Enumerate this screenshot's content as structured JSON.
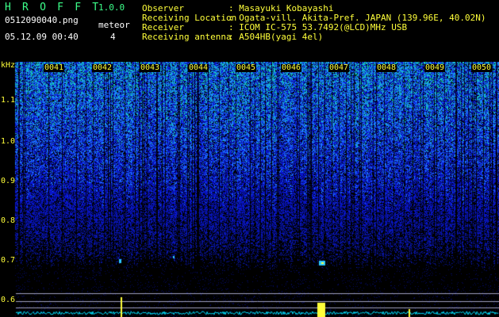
{
  "header": {
    "app_title": "H R O F F T",
    "app_version": "1.0.0",
    "file_name": "0512090040.png",
    "meteor_label": "meteor",
    "meteor_count": "4",
    "date_time": "05.12.09 00:40",
    "info": [
      {
        "label": "Observer",
        "value": ": Masayuki Kobayashi"
      },
      {
        "label": "Receiving Location",
        "value": ": Ogata-vill. Akita-Pref. JAPAN (139.96E, 40.02N)"
      },
      {
        "label": "Receiver",
        "value": ": ICOM IC-575 53.7492(@LCD)MHz USB"
      },
      {
        "label": "Receiving antenna",
        "value": ": A504HB(yagi 4el)"
      }
    ]
  },
  "spectrogram": {
    "y_unit": "kHz",
    "y_ticks": [
      "1.1",
      "1.0",
      "0.9",
      "0.8",
      "0.7",
      "0.6"
    ],
    "time_labels": [
      "0041",
      "0042",
      "0043",
      "0044",
      "0045",
      "0046",
      "0047",
      "0048",
      "0049",
      "0050"
    ],
    "colors": {
      "background": "#000000",
      "text": "#ffff3a",
      "title": "#3cff8a",
      "noise_low": "#0a1a8a",
      "noise_mid": "#2050ff",
      "noise_high": "#20c0c0",
      "trace": "#2cc8ff",
      "baseline": "#00e0ff",
      "ref_lines": "#a0a0c0"
    }
  }
}
